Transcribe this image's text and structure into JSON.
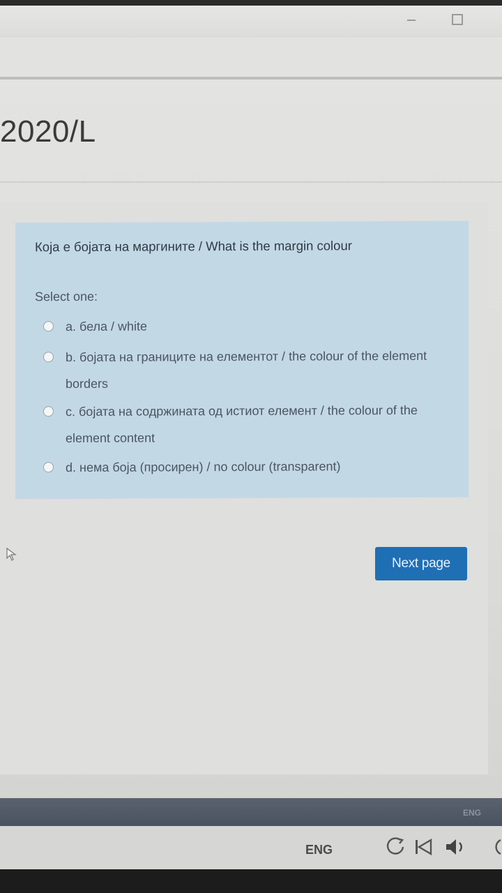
{
  "page": {
    "course_code": "2020/L"
  },
  "question": {
    "text": "Која е бојата на маргините  / What is the margin colour",
    "prompt": "Select one:",
    "options": [
      {
        "label": "a. бела / white"
      },
      {
        "label": "b. бојата на границите на елементот / the colour of the element borders"
      },
      {
        "label": "c. бојата на содржината од истиот елемент / the colour of the element content"
      },
      {
        "label": "d. нема боја (просирен) / no colour (transparent)"
      }
    ]
  },
  "navigation": {
    "next_label": "Next page"
  },
  "taskbar": {
    "lang_top": "ENG",
    "lang": "ENG"
  },
  "icons": {
    "refresh": "refresh-icon",
    "skip_back": "skip-back-icon",
    "volume": "volume-icon",
    "cursor": "mouse-cursor-icon"
  },
  "colors": {
    "question_bg": "#c3d8e5",
    "button_bg": "#1f6fb5"
  }
}
